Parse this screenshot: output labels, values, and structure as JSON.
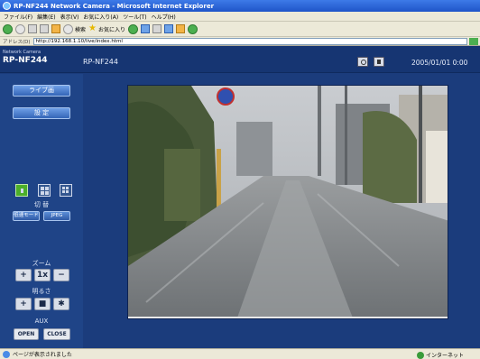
{
  "window": {
    "title": "RP-NF244 Network Camera - Microsoft Internet Explorer"
  },
  "menu": {
    "items": [
      "ファイル(F)",
      "編集(E)",
      "表示(V)",
      "お気に入り(A)",
      "ツール(T)",
      "ヘルプ(H)"
    ]
  },
  "toolbar": {
    "search_label": "検索",
    "favorites_label": "お気に入り"
  },
  "address": {
    "label": "アドレス(D)",
    "value": "http://192.168.1.10/live/index.html"
  },
  "camera": {
    "brand_small": "Network Camera",
    "model": "RP-NF244",
    "name": "RP-NF244",
    "datetime": "2005/01/01  0:00"
  },
  "panel": {
    "live_button": "ライブ画",
    "settings_button": "設 定",
    "switch_label": "切 替",
    "fps_low": "低速モード",
    "fps_high": "JPEG",
    "zoom_label": "ズーム",
    "zoom_in": "+",
    "zoom_reset": "1x",
    "zoom_out": "−",
    "bright_label": "明るさ",
    "bright_up": "+",
    "bright_reset": "■",
    "bright_down": "✱",
    "aux_label": "AUX",
    "aux_open": "OPEN",
    "aux_close": "CLOSE"
  },
  "status": {
    "text": "ページが表示されました",
    "zone": "インターネット"
  },
  "colors": {
    "accent_green": "#4caf2a",
    "panel_blue": "#1f4487"
  }
}
